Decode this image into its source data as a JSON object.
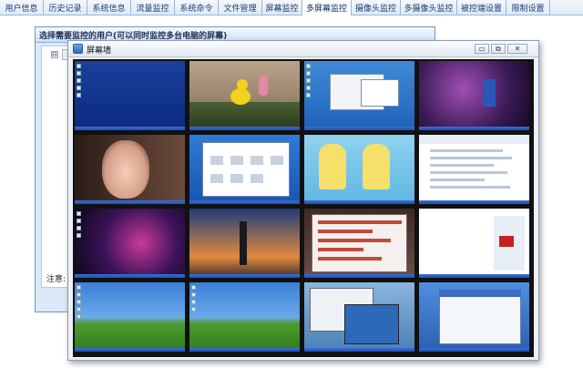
{
  "tabs": [
    {
      "label": "用户信息",
      "active": false
    },
    {
      "label": "历史记录",
      "active": false
    },
    {
      "label": "系统信息",
      "active": false
    },
    {
      "label": "流量监控",
      "active": false
    },
    {
      "label": "系统命令",
      "active": false
    },
    {
      "label": "文件管理",
      "active": false
    },
    {
      "label": "屏幕监控",
      "active": false
    },
    {
      "label": "多屏幕监控",
      "active": true
    },
    {
      "label": "摄像头监控",
      "active": false
    },
    {
      "label": "多摄像头监控",
      "active": false
    },
    {
      "label": "被控端设置",
      "active": false
    },
    {
      "label": "限制设置",
      "active": false
    }
  ],
  "background_dialog": {
    "title": "选择需要监控的用户(可以同时监控多台电脑的屏幕)",
    "tree_toggle": "⊟",
    "notice": "注意:"
  },
  "screen_wall": {
    "title": "屏幕墙",
    "min_symbol": "▭",
    "max_symbol": "⧉",
    "close_symbol": "✕"
  },
  "colors": {
    "accent": "#9db6d8",
    "tab_text": "#1b3c73",
    "dialog_bg": "#dce9f8"
  }
}
